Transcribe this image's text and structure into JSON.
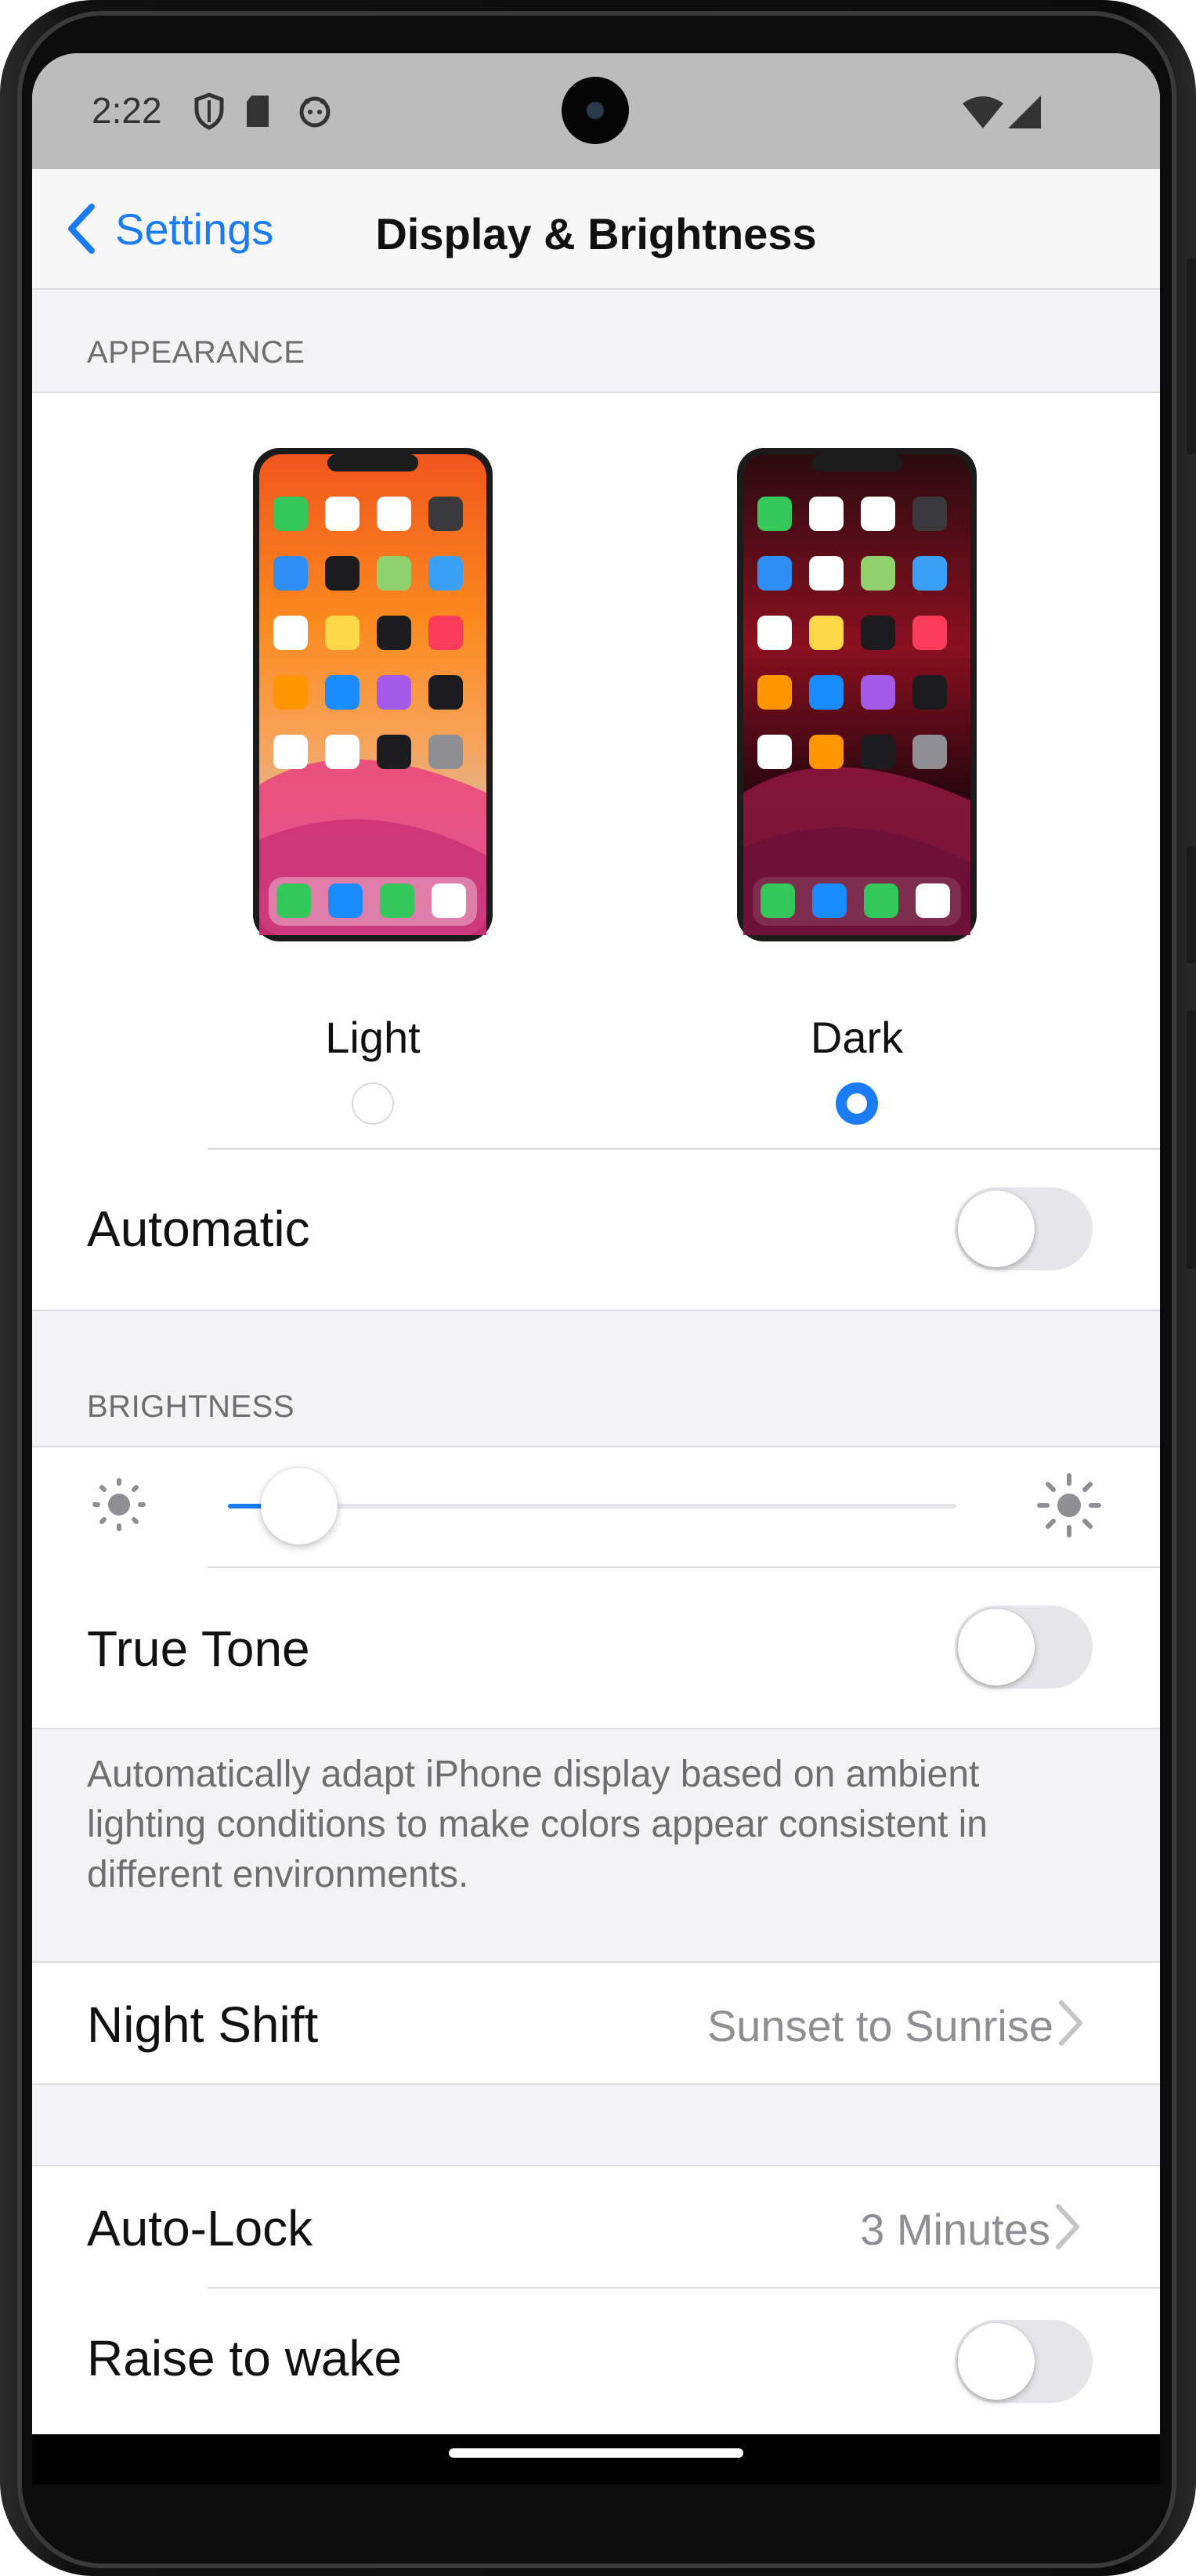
{
  "status_bar": {
    "time": "2:22",
    "icons": [
      "shield-icon",
      "sd-card-icon",
      "android-icon",
      "wifi-icon",
      "cellular-signal-icon"
    ]
  },
  "nav": {
    "back_label": "Settings",
    "title": "Display & Brightness"
  },
  "appearance": {
    "header": "APPEARANCE",
    "options": [
      {
        "label": "Light",
        "selected": false
      },
      {
        "label": "Dark",
        "selected": true
      }
    ],
    "automatic_label": "Automatic",
    "automatic_on": false
  },
  "brightness": {
    "header": "BRIGHTNESS",
    "level": 0.05,
    "true_tone_label": "True Tone",
    "true_tone_on": false,
    "true_tone_footer": "Automatically adapt iPhone display based on ambient lighting conditions to make colors appear consistent in different environments."
  },
  "night_shift": {
    "label": "Night Shift",
    "value": "Sunset to Sunrise"
  },
  "auto_lock": {
    "label": "Auto-Lock",
    "value": "3 Minutes"
  },
  "raise_to_wake": {
    "label": "Raise to wake",
    "on": false
  },
  "colors": {
    "accent": "#1a7cf5",
    "grouped_background": "#f2f2f7",
    "secondary_text": "#8e8e93"
  }
}
